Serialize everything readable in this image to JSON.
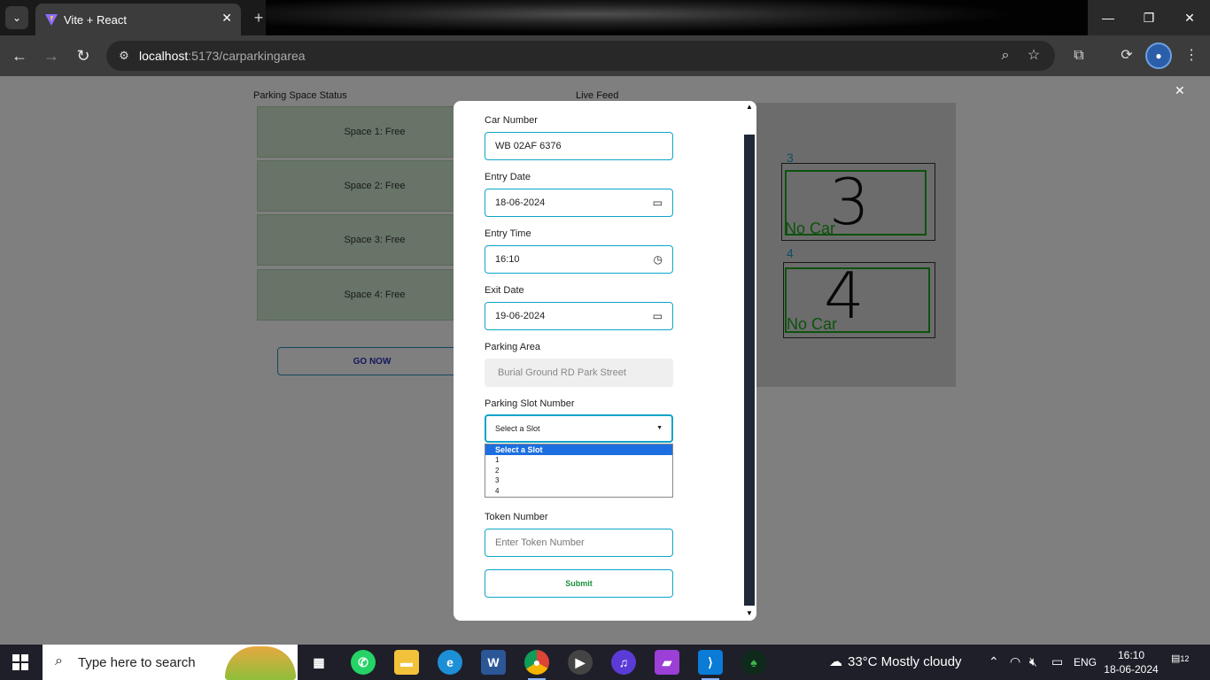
{
  "browser": {
    "tab_title": "Vite + React",
    "url_host": "localhost",
    "url_path": ":5173/carparkingarea",
    "new_tab": "+",
    "tab_close": "✕"
  },
  "page": {
    "status_title": "Parking Space Status",
    "live_title": "Live Feed",
    "spaces": [
      "Space 1: Free",
      "Space 2: Free",
      "Space 3: Free",
      "Space 4: Free"
    ],
    "go_now": "GO NOW",
    "feed": {
      "slots": [
        {
          "index": "3",
          "digit": "3",
          "label": "No Car"
        },
        {
          "index": "4",
          "digit": "4",
          "label": "No Car"
        }
      ]
    },
    "close": "✕"
  },
  "form": {
    "car_number_label": "Car Number",
    "car_number_value": "WB 02AF 6376",
    "entry_date_label": "Entry Date",
    "entry_date_value": "18-06-2024",
    "entry_time_label": "Entry Time",
    "entry_time_value": "16:10",
    "exit_date_label": "Exit Date",
    "exit_date_value": "19-06-2024",
    "parking_area_label": "Parking Area",
    "parking_area_value": "Burial Ground RD Park Street",
    "slot_label": "Parking Slot Number",
    "slot_selected": "Select a Slot",
    "slot_options": [
      "Select a Slot",
      "1",
      "2",
      "3",
      "4"
    ],
    "token_label": "Token Number",
    "token_placeholder": "Enter Token Number",
    "submit": "Submit"
  },
  "taskbar": {
    "search_placeholder": "Type here to search",
    "weather": "33°C  Mostly cloudy",
    "language": "ENG",
    "time": "16:10",
    "date": "18-06-2024",
    "notifications": "12"
  },
  "colors": {
    "accent": "#0ea5c8",
    "free_space": "#cfe8cf",
    "submit_text": "#1a8f3a",
    "go_now_text": "#2b2fc0",
    "scroll_thumb": "#1f2937"
  }
}
